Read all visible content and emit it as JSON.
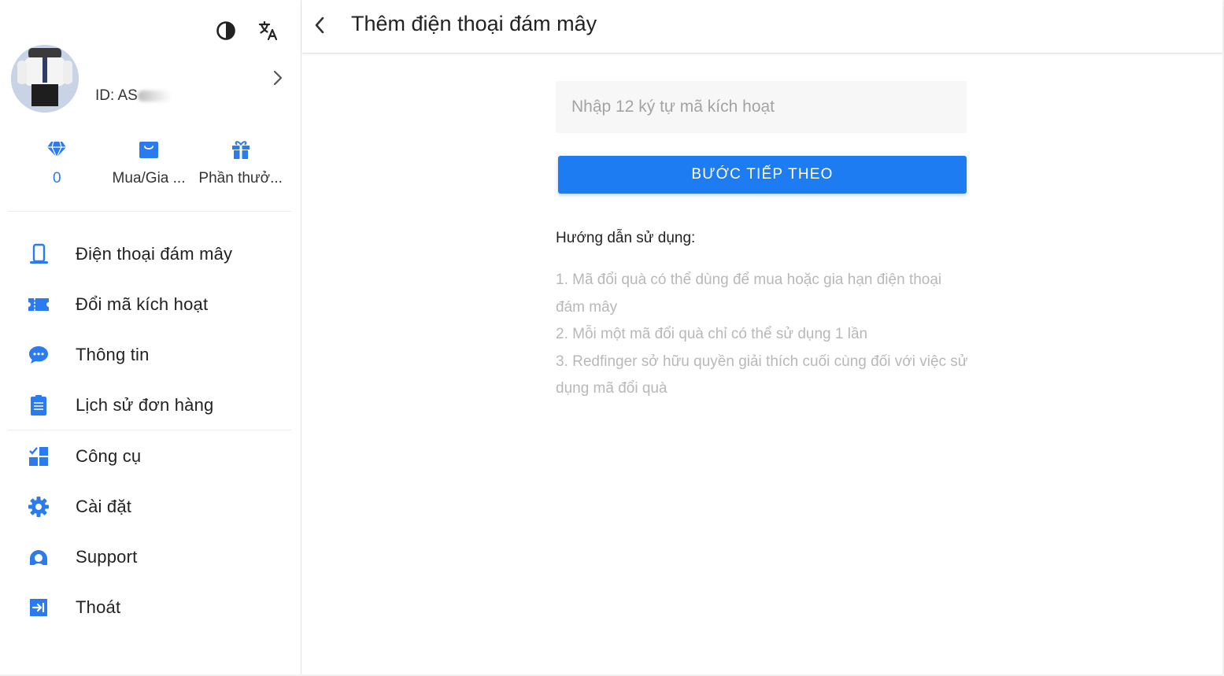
{
  "sidebar": {
    "user": {
      "id_label": "ID: AS"
    },
    "stats": [
      {
        "icon": "diamond-icon",
        "label": "0"
      },
      {
        "icon": "shopping-bag-icon",
        "label": "Mua/Gia ..."
      },
      {
        "icon": "gift-icon",
        "label": "Phần thưở..."
      }
    ],
    "nav": [
      {
        "icon": "phone-icon",
        "label": "Điện thoại đám mây"
      },
      {
        "icon": "ticket-icon",
        "label": "Đổi mã kích hoạt"
      },
      {
        "icon": "chat-icon",
        "label": "Thông tin"
      },
      {
        "icon": "clipboard-icon",
        "label": "Lịch sử đơn hàng"
      },
      {
        "icon": "tools-icon",
        "label": "Công cụ"
      },
      {
        "icon": "settings-icon",
        "label": "Cài đặt"
      },
      {
        "icon": "support-icon",
        "label": "Support"
      },
      {
        "icon": "logout-icon",
        "label": "Thoát"
      }
    ]
  },
  "header": {
    "title": "Thêm điện thoại đám mây"
  },
  "form": {
    "placeholder": "Nhập 12 ký tự mã kích hoạt",
    "value": "",
    "next_label": "BƯỚC TIẾP THEO"
  },
  "guide": {
    "title": "Hướng dẫn sử dụng:",
    "items": [
      "1. Mã đổi quà có thể dùng để mua hoặc gia hạn điện thoại đám mây",
      "2. Mỗi một mã đổi quà chỉ có thể sử dụng 1 lần",
      "3. Redfinger sở hữu quyền giải thích cuối cùng đối với việc sử dụng mã đổi quà"
    ]
  },
  "colors": {
    "accent": "#1e7cf2",
    "icon_blue": "#2a7af0",
    "muted_text": "#b8b8b8"
  }
}
